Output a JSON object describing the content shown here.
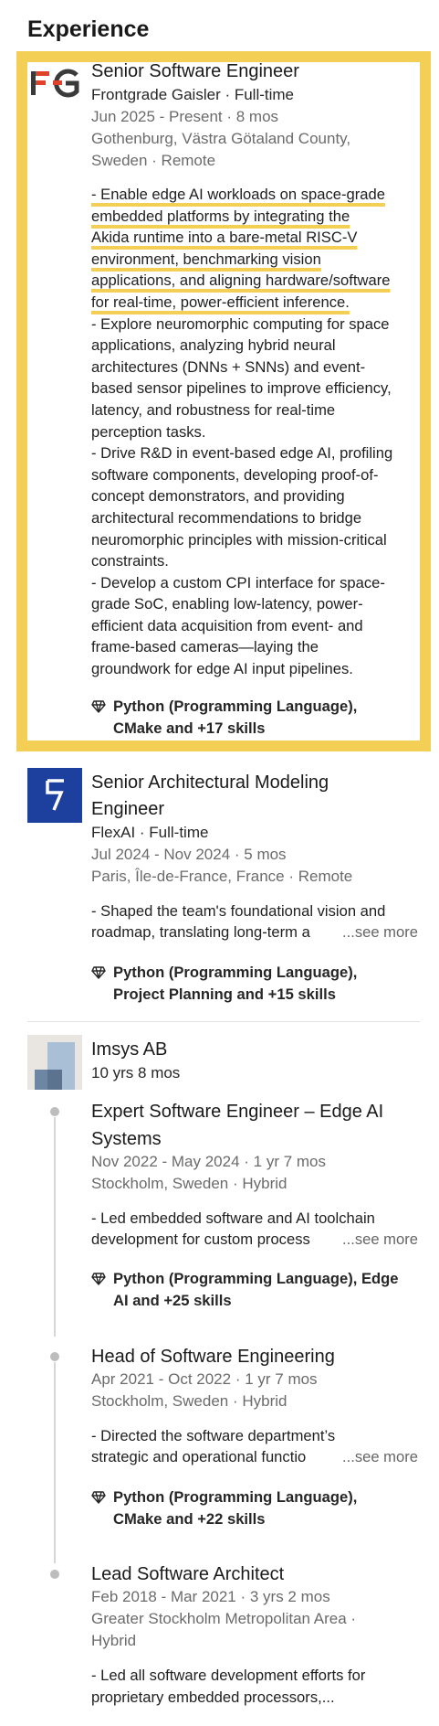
{
  "section": {
    "title": "Experience"
  },
  "jobs": [
    {
      "title": "Senior Software Engineer",
      "company": "Frontgrade Gaisler · Full-time",
      "dates": "Jun 2025 - Present · 8 mos",
      "location_line1": "Gothenburg, Västra Götaland County,",
      "location_line2": "Sweden · Remote",
      "desc_lines": [
        "- Enable edge AI workloads on space-grade",
        "embedded platforms by integrating the",
        "Akida runtime into a bare-metal RISC-V",
        "environment, benchmarking vision",
        "applications, and aligning hardware/software",
        "for real-time, power-efficient inference.",
        "- Explore neuromorphic computing for space",
        "applications, analyzing hybrid neural",
        "architectures (DNNs + SNNs) and event-",
        "based sensor pipelines to improve efficiency,",
        "latency, and robustness for real-time",
        "perception tasks.",
        "- Drive R&D in event-based edge AI, profiling",
        "software components, developing proof-of-",
        "concept demonstrators, and providing",
        "architectural recommendations to bridge",
        "neuromorphic principles with mission-critical",
        "constraints.",
        "- Develop a custom CPI interface for space-",
        "grade SoC, enabling low-latency, power-",
        "efficient data acquisition from event- and",
        "frame-based cameras—laying the",
        "groundwork for edge AI input pipelines."
      ],
      "skills_line1": "Python (Programming Language),",
      "skills_line2": "CMake and +17 skills"
    },
    {
      "title_line1": "Senior Architectural Modeling",
      "title_line2": "Engineer",
      "company": "FlexAI · Full-time",
      "dates": "Jul 2024 - Nov 2024 · 5 mos",
      "location": "Paris, Île-de-France, France · Remote",
      "desc_line1": "- Shaped the team's foundational vision and",
      "desc_line2": "roadmap, translating long-term a",
      "see_more": "...see more",
      "skills_line1": "Python (Programming Language),",
      "skills_line2": "Project Planning and +15 skills"
    }
  ],
  "company_group": {
    "name": "Imsys AB",
    "duration": "10 yrs 8 mos",
    "roles": [
      {
        "title_line1": "Expert Software Engineer – Edge AI",
        "title_line2": "Systems",
        "dates": "Nov 2022 - May 2024 · 1 yr 7 mos",
        "location": "Stockholm, Sweden · Hybrid",
        "desc_line1": "- Led embedded software and AI toolchain",
        "desc_line2": "development for custom process",
        "see_more": "...see more",
        "skills_line1": "Python (Programming Language), Edge",
        "skills_line2": "AI and +25 skills"
      },
      {
        "title": "Head of Software Engineering",
        "dates": "Apr 2021 - Oct 2022 · 1 yr 7 mos",
        "location": "Stockholm, Sweden · Hybrid",
        "desc_line1": "- Directed the software department’s",
        "desc_line2": "strategic and operational functio",
        "see_more": "...see more",
        "skills_line1": "Python (Programming Language),",
        "skills_line2": "CMake and +22 skills"
      },
      {
        "title": "Lead Software Architect",
        "dates": "Feb 2018 - Mar 2021 · 3 yrs 2 mos",
        "location_line1": "Greater Stockholm Metropolitan Area ·",
        "location_line2": "Hybrid",
        "desc_line1": "- Led all software development efforts for",
        "desc_line2": "proprietary embedded processors,..."
      }
    ]
  },
  "colors": {
    "highlight": "#f4cf55",
    "flexai_blue": "#1d3f9e",
    "fg_red": "#e0412b",
    "fg_dark": "#3a3a3a"
  },
  "icons": [
    "frontgrade-logo",
    "flexai-logo",
    "imsys-logo",
    "skills-gem-icon",
    "timeline-dot"
  ]
}
